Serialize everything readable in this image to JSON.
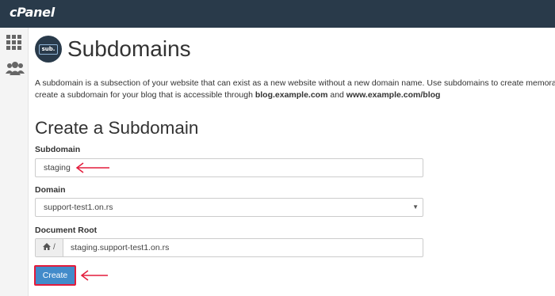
{
  "app": {
    "brand": "cPanel"
  },
  "sidebar": {
    "items": [
      {
        "icon": "grid-icon"
      },
      {
        "icon": "users-icon"
      }
    ]
  },
  "page": {
    "icon_text": "sub.",
    "title": "Subdomains",
    "desc_line1": "A subdomain is a subsection of your website that can exist as a new website without a new domain name. Use subdomains to create memorab",
    "desc_line2_pre": "create a subdomain for your blog that is accessible through ",
    "desc_line2_ex1": "blog.example.com",
    "desc_line2_mid": " and ",
    "desc_line2_ex2": "www.example.com/blog"
  },
  "form": {
    "section_title": "Create a Subdomain",
    "subdomain_label": "Subdomain",
    "subdomain_value": "staging",
    "domain_label": "Domain",
    "domain_value": "support-test1.on.rs",
    "docroot_label": "Document Root",
    "docroot_prefix": "/",
    "docroot_value": "staging.support-test1.on.rs",
    "create_label": "Create"
  },
  "colors": {
    "topbar": "#293a4a",
    "button": "#428bca",
    "annotation": "#e31b3b"
  }
}
